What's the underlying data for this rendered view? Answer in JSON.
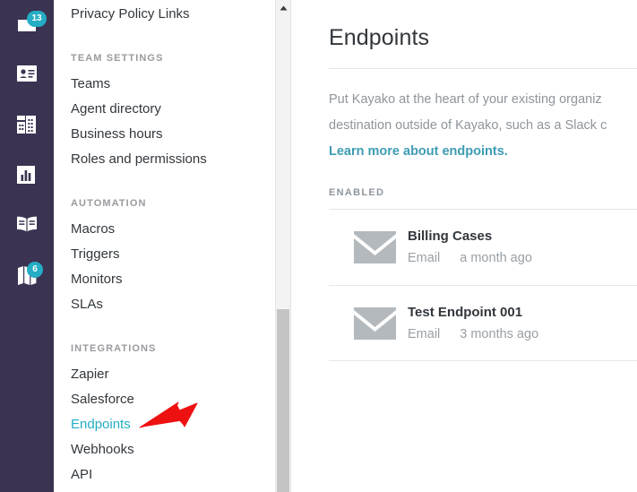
{
  "rail": {
    "items": [
      {
        "icon": "inbox-icon",
        "badge": "13"
      },
      {
        "icon": "contact-card-icon",
        "badge": null
      },
      {
        "icon": "buildings-icon",
        "badge": null
      },
      {
        "icon": "bar-chart-icon",
        "badge": null
      },
      {
        "icon": "book-icon",
        "badge": null
      },
      {
        "icon": "map-icon",
        "badge": "6"
      }
    ],
    "badge_color": "#24adc4",
    "background_color": "#3b3352"
  },
  "nav": {
    "top_item": {
      "label": "Privacy Policy Links",
      "active": false
    },
    "groups": [
      {
        "title": "TEAM SETTINGS",
        "items": [
          {
            "label": "Teams",
            "active": false
          },
          {
            "label": "Agent directory",
            "active": false
          },
          {
            "label": "Business hours",
            "active": false
          },
          {
            "label": "Roles and permissions",
            "active": false
          }
        ]
      },
      {
        "title": "AUTOMATION",
        "items": [
          {
            "label": "Macros",
            "active": false
          },
          {
            "label": "Triggers",
            "active": false
          },
          {
            "label": "Monitors",
            "active": false
          },
          {
            "label": "SLAs",
            "active": false
          }
        ]
      },
      {
        "title": "INTEGRATIONS",
        "items": [
          {
            "label": "Zapier",
            "active": false
          },
          {
            "label": "Salesforce",
            "active": false
          },
          {
            "label": "Endpoints",
            "active": true
          },
          {
            "label": "Webhooks",
            "active": false
          },
          {
            "label": "API",
            "active": false
          }
        ]
      }
    ],
    "active_color": "#24adc4",
    "scrollbar": {
      "up_arrow": "chevron-up-icon"
    }
  },
  "main": {
    "title": "Endpoints",
    "intro_line_1": "Put Kayako at the heart of your existing organiz",
    "intro_line_2": "destination outside of Kayako, such as a Slack c",
    "intro_link": "Learn more about endpoints.",
    "link_color": "#3d9cb3",
    "section_label": "ENABLED",
    "endpoints": [
      {
        "icon": "envelope-icon",
        "name": "Billing Cases",
        "type": "Email",
        "updated": "a month ago"
      },
      {
        "icon": "envelope-icon",
        "name": "Test Endpoint 001",
        "type": "Email",
        "updated": "3 months ago"
      }
    ]
  },
  "annotation": {
    "arrow_color": "#ee1111",
    "points_to": "Endpoints"
  }
}
